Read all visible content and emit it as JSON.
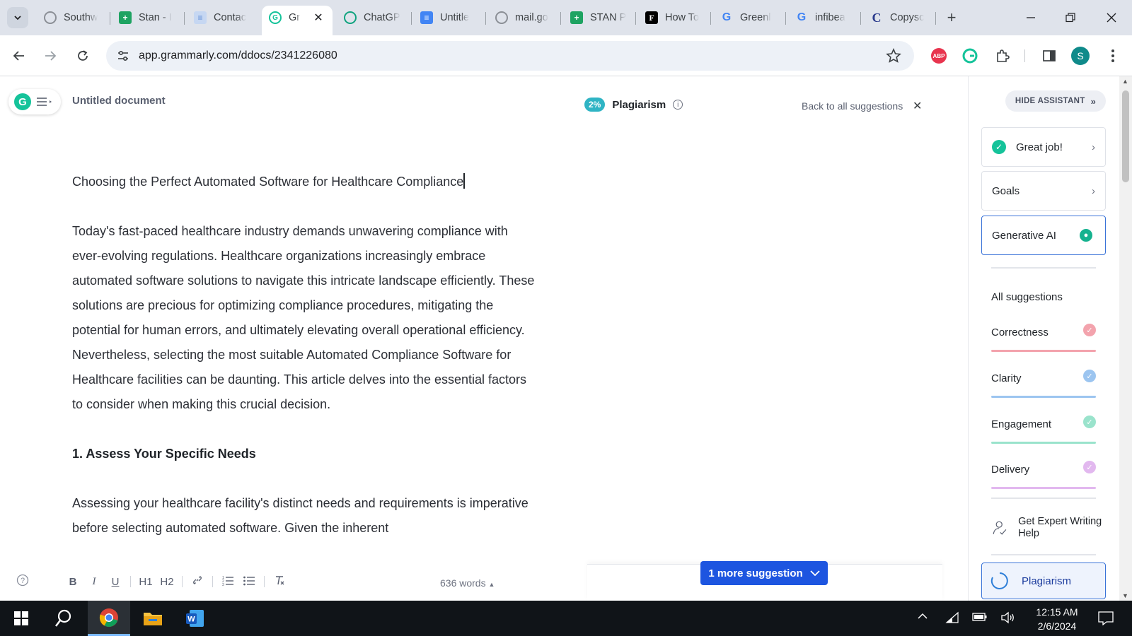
{
  "browser": {
    "tabs": [
      {
        "title": "Southw",
        "icon": "globe-icon",
        "color": "#8b8f96"
      },
      {
        "title": "Stan - I",
        "icon": "sheets-icon",
        "color": "#1ea362"
      },
      {
        "title": "Contac",
        "icon": "form-icon",
        "color": "#5f8bd6"
      },
      {
        "title": "Gr",
        "icon": "grammarly-icon",
        "color": "#15c39a",
        "active": true
      },
      {
        "title": "ChatGP",
        "icon": "chatgpt-icon",
        "color": "#10a37f"
      },
      {
        "title": "Untitle",
        "icon": "docs-icon",
        "color": "#4285f4"
      },
      {
        "title": "mail.go",
        "icon": "globe-icon",
        "color": "#8b8f96"
      },
      {
        "title": "STAN P",
        "icon": "sheets-icon",
        "color": "#1ea362"
      },
      {
        "title": "How To",
        "icon": "forbes-icon",
        "color": "#000000"
      },
      {
        "title": "Greenl",
        "icon": "google-icon",
        "color": "#4285f4"
      },
      {
        "title": "infibea",
        "icon": "google-icon",
        "color": "#4285f4"
      },
      {
        "title": "Copysc",
        "icon": "copyscape-icon",
        "color": "#2a3a8c"
      }
    ],
    "url": "app.grammarly.com/ddocs/2341226080",
    "profile_initial": "S",
    "abp_label": "ABP"
  },
  "editor": {
    "doc_title": "Untitled document",
    "plagiarism_pct": "2%",
    "plagiarism_label": "Plagiarism",
    "back_link": "Back to all suggestions",
    "heading": "Choosing the Perfect Automated Software for Healthcare Compliance",
    "para1": "Today's fast-paced healthcare industry demands unwavering compliance with ever-evolving regulations. Healthcare organizations increasingly embrace automated software solutions to navigate this intricate landscape efficiently. These solutions are precious for optimizing compliance procedures, mitigating the potential for human errors, and ultimately elevating overall operational efficiency. Nevertheless, selecting the most suitable Automated Compliance Software for Healthcare facilities can be daunting. This article delves into the essential factors to consider when making this crucial decision.",
    "section1": "1. Assess Your Specific Needs",
    "para2": "Assessing your healthcare facility's distinct needs and requirements is imperative before selecting automated software. Given the inherent",
    "word_count": "636 words",
    "more_suggestion": "1 more suggestion",
    "format": {
      "bold": "B",
      "italic": "I",
      "underline": "U",
      "h1": "H1",
      "h2": "H2"
    }
  },
  "assistant": {
    "hide_label": "HIDE ASSISTANT",
    "great_job": "Great job!",
    "goals": "Goals",
    "gen_ai": "Generative AI",
    "all_suggestions": "All suggestions",
    "categories": [
      {
        "label": "Correctness",
        "color": "#f3a3ad"
      },
      {
        "label": "Clarity",
        "color": "#9cc5f0"
      },
      {
        "label": "Engagement",
        "color": "#9ae3cc"
      },
      {
        "label": "Delivery",
        "color": "#e2b8ef"
      }
    ],
    "expert_help": "Get Expert Writing Help",
    "plagiarism": "Plagiarism"
  },
  "taskbar": {
    "time": "12:15 AM",
    "date": "2/6/2024"
  }
}
